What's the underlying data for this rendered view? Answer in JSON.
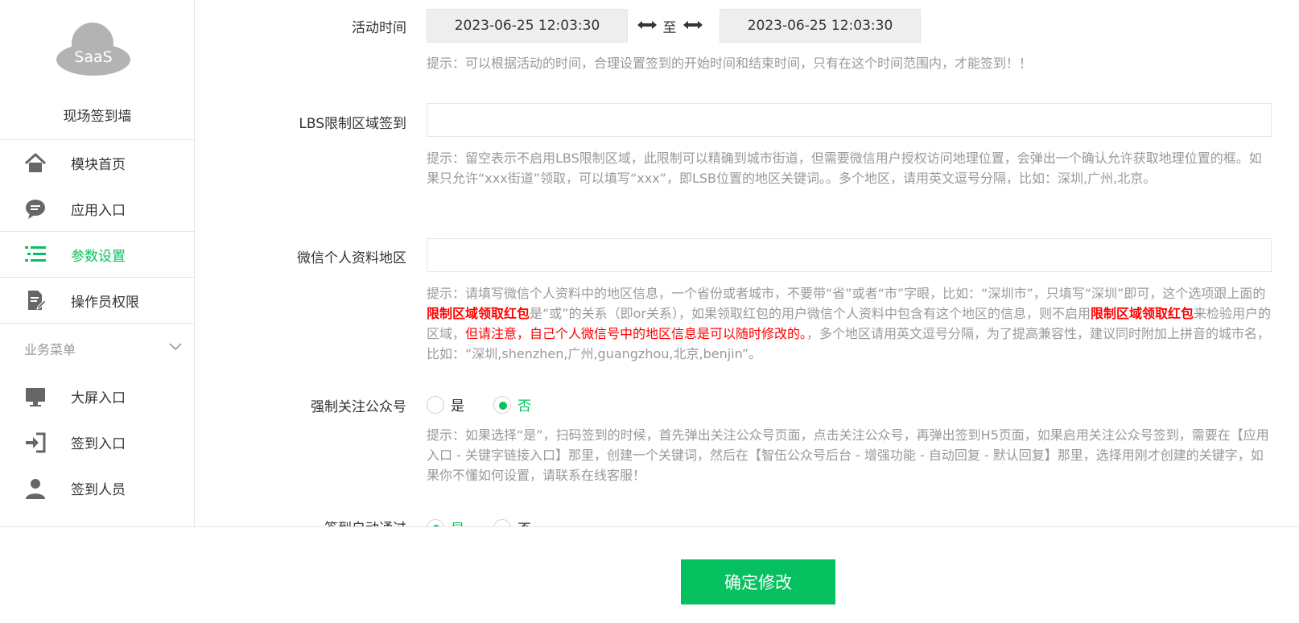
{
  "sidebar": {
    "logo_text": "SaaS",
    "app_name": "现场签到墙",
    "items": [
      {
        "label": "模块首页",
        "icon": "home-icon"
      },
      {
        "label": "应用入口",
        "icon": "chat-bubble-icon"
      },
      {
        "label": "参数设置",
        "icon": "list-icon",
        "active": true
      },
      {
        "label": "操作员权限",
        "icon": "document-edit-icon"
      }
    ],
    "section_label": "业务菜单",
    "section_items": [
      {
        "label": "大屏入口",
        "icon": "monitor-icon"
      },
      {
        "label": "签到入口",
        "icon": "sign-in-icon"
      },
      {
        "label": "签到人员",
        "icon": "user-icon"
      }
    ]
  },
  "form": {
    "activity_time": {
      "label": "活动时间",
      "start": "2023-06-25 12:03:30",
      "separator": "至",
      "end": "2023-06-25 12:03:30",
      "hint": "提示：可以根据活动的时间，合理设置签到的开始时间和结束时间，只有在这个时间范围内，才能签到！！"
    },
    "lbs": {
      "label": "LBS限制区域签到",
      "value": "",
      "hint": "提示：留空表示不启用LBS限制区域，此限制可以精确到城市街道，但需要微信用户授权访问地理位置，会弹出一个确认允许获取地理位置的框。如果只允许“xxx街道”领取，可以填写“xxx”，即LSB位置的地区关键词。。多个地区，请用英文逗号分隔，比如：深圳,广州,北京。"
    },
    "wechat_region": {
      "label": "微信个人资料地区",
      "value": "",
      "hint_1": "提示：请填写微信个人资料中的地区信息，一个省份或者城市，不要带“省”或者“市”字眼，比如：“深圳市”，只填写“深圳”即可，这个选项跟上面的",
      "hint_em_1": "限制区域领取红包",
      "hint_2": "是“或”的关系（即or关系），如果领取红包的用户微信个人资料中包含有这个地区的信息，则不启用",
      "hint_em_2": "限制区域领取红包",
      "hint_3": "来检验用户的区域，",
      "hint_warn": "但请注意，自己个人微信号中的地区信息是可以随时修改的。",
      "hint_4": "，多个地区请用英文逗号分隔，为了提高兼容性，建议同时附加上拼音的城市名，比如：“深圳,shenzhen,广州,guangzhou,北京,benjin”。"
    },
    "force_follow": {
      "label": "强制关注公众号",
      "option_yes": "是",
      "option_no": "否",
      "selected": "否",
      "hint": "提示：如果选择“是”，扫码签到的时候，首先弹出关注公众号页面，点击关注公众号，再弹出签到H5页面，如果启用关注公众号签到，需要在【应用入口 - 关键字链接入口】那里，创建一个关键词，然后在【智伍公众号后台 - 增强功能 - 自动回复 - 默认回复】那里，选择用刚才创建的关键字，如果你不懂如何设置，请联系在线客服！"
    },
    "auto_pass": {
      "label": "签到自动通过",
      "option_yes": "是",
      "option_no": "否",
      "selected": "是"
    }
  },
  "footer": {
    "submit_label": "确定修改"
  },
  "colors": {
    "accent": "#07c160",
    "warning": "#ff0000",
    "hint": "#999999"
  }
}
